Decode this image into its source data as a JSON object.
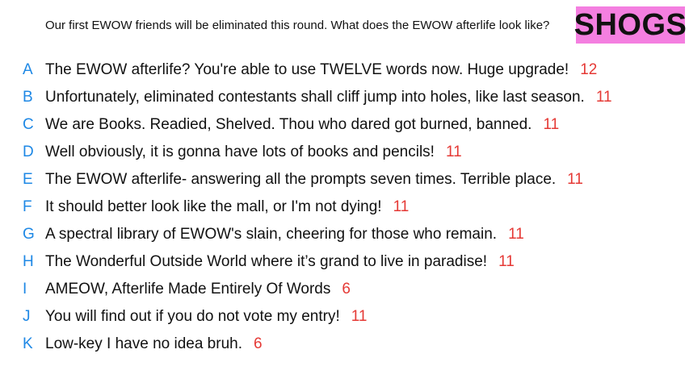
{
  "prompt": "Our first EWOW friends will be eliminated this round. What does the EWOW afterlife look like?",
  "badge": "SHOGS",
  "colors": {
    "letter": "#1e88e5",
    "count": "#e53935",
    "badge_bg": "#f47fe0"
  },
  "responses": [
    {
      "letter": "A",
      "text": "The EWOW afterlife? You're able to use TWELVE words now. Huge upgrade!",
      "count": "12"
    },
    {
      "letter": "B",
      "text": "Unfortunately, eliminated contestants shall cliff jump into holes, like last season.",
      "count": "11"
    },
    {
      "letter": "C",
      "text": "We are Books. Readied, Shelved. Thou who dared got burned, banned.",
      "count": "11"
    },
    {
      "letter": "D",
      "text": "Well obviously, it is gonna have lots of books and pencils!",
      "count": "11"
    },
    {
      "letter": "E",
      "text": "The EWOW afterlife- answering all the prompts seven times. Terrible place.",
      "count": "11"
    },
    {
      "letter": "F",
      "text": "It should better look like the mall, or I'm not dying!",
      "count": "11"
    },
    {
      "letter": "G",
      "text": "A spectral library of EWOW's slain, cheering for those who remain.",
      "count": "11"
    },
    {
      "letter": "H",
      "text": "The Wonderful Outside World where it’s grand to live in paradise!",
      "count": "11"
    },
    {
      "letter": "I",
      "text": "AMEOW, Afterlife Made Entirely Of Words",
      "count": "6"
    },
    {
      "letter": "J",
      "text": "You will find out if you do not vote my entry!",
      "count": "11"
    },
    {
      "letter": "K",
      "text": "Low-key I have no idea bruh.",
      "count": "6"
    }
  ]
}
